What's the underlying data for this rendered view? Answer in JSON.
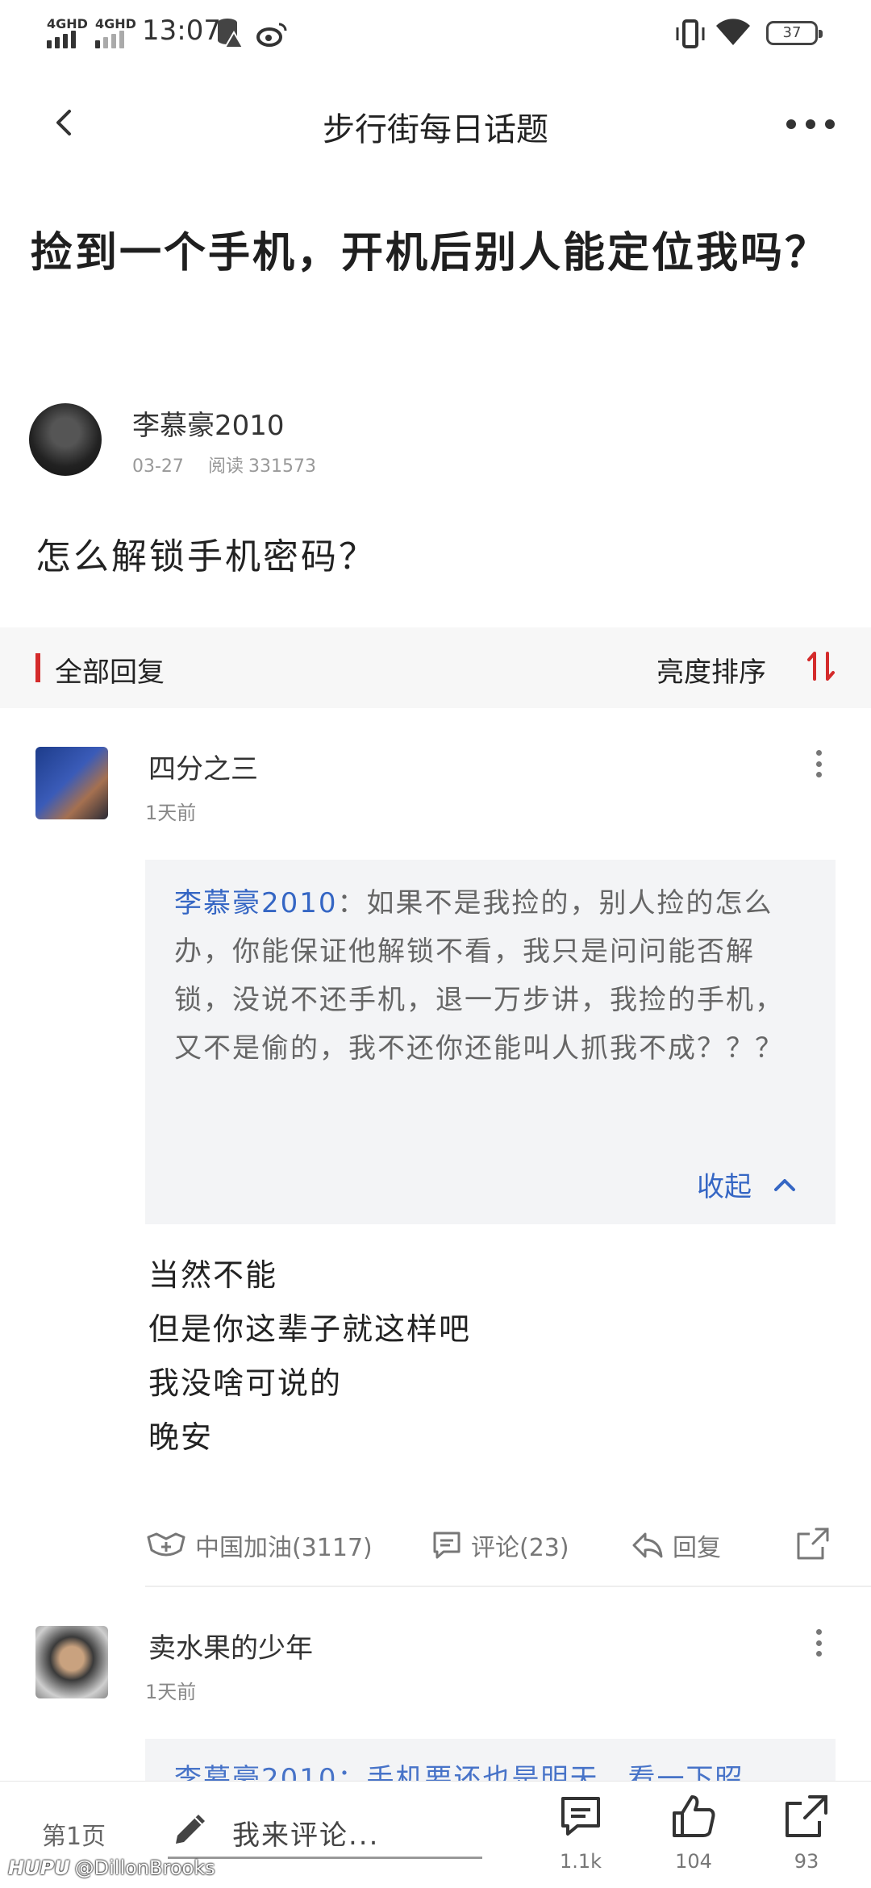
{
  "status_bar": {
    "network_1": "4GHD",
    "network_2": "4GHD",
    "time": "13:07",
    "battery": "37"
  },
  "nav": {
    "title": "步行街每日话题"
  },
  "post": {
    "title": "捡到一个手机，开机后别人能定位我吗？",
    "author": "李慕豪2010",
    "date": "03-27",
    "reads_label": "阅读",
    "reads": "331573",
    "body": "怎么解锁手机密码？"
  },
  "replies_header": {
    "title": "全部回复",
    "sort_label": "亮度排序"
  },
  "comments": [
    {
      "name": "四分之三",
      "time": "1天前",
      "quote_author": "李慕豪2010",
      "quote_text": "：如果不是我捡的，别人捡的怎么办，你能保证他解锁不看，我只是问问能否解锁，没说不还手机，退一万步讲，我捡的手机，又不是偷的，我不还你还能叫人抓我不成？？？",
      "collapse_label": "收起",
      "lines": [
        "当然不能",
        "但是你这辈子就这样吧",
        "我没啥可说的",
        "晚安"
      ],
      "cheer_label": "中国加油(3117)",
      "comment_label": "评论(23)",
      "reply_label": "回复"
    },
    {
      "name": "卖水果的少年",
      "time": "1天前",
      "quote_partial": "李慕豪2010：手机要还也是明天，看一下昭"
    }
  ],
  "bottom_bar": {
    "page_label": "第1页",
    "comment_placeholder": "我来评论...",
    "comments_count": "1.1k",
    "likes_count": "104",
    "shares_count": "93"
  },
  "watermark": {
    "brand": "HUPU",
    "user": "@DillonBrooks"
  },
  "colors": {
    "accent_red": "#d42b2b",
    "link_blue": "#3566c4"
  }
}
